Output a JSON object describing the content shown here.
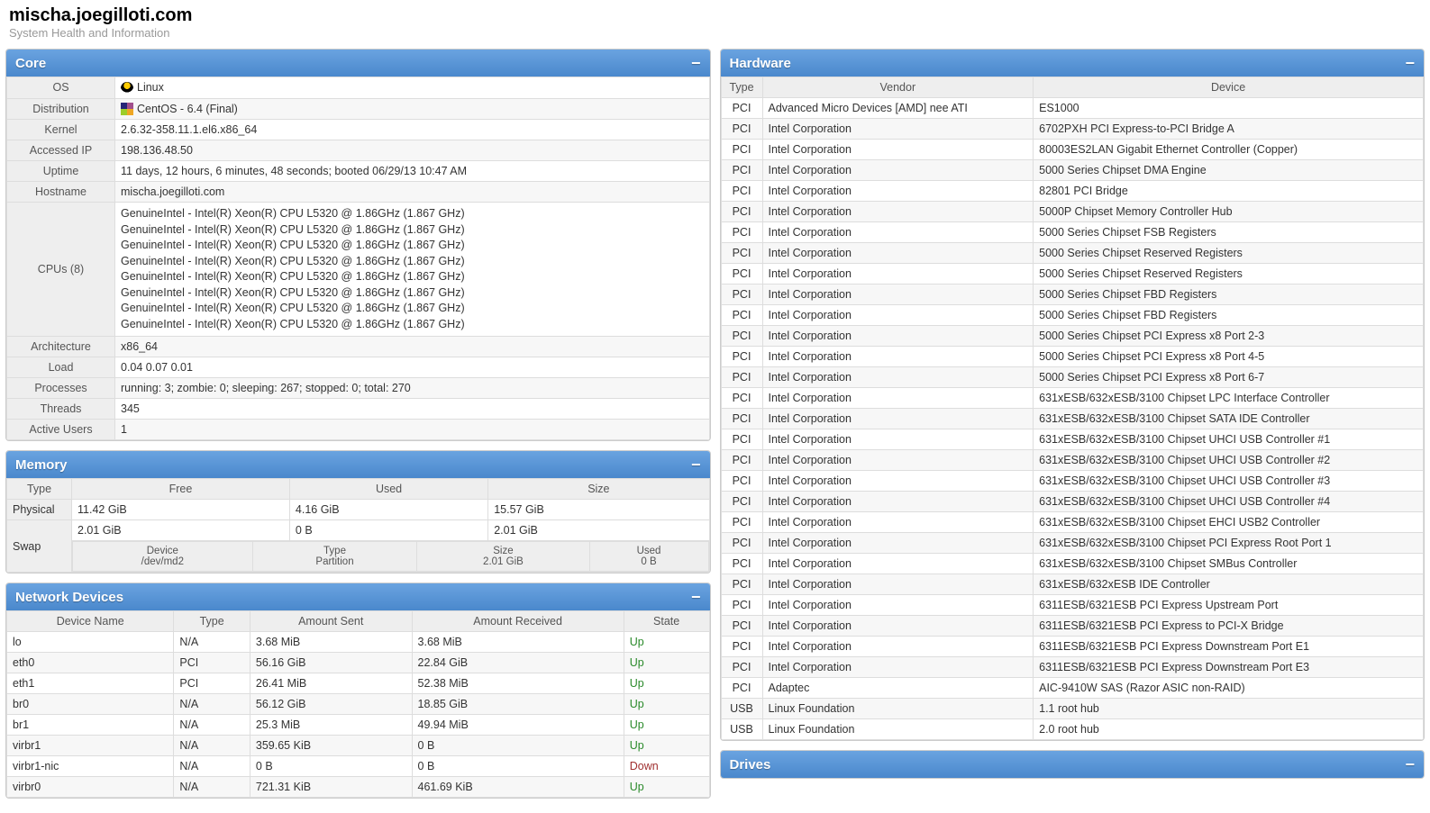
{
  "header": {
    "title": "mischa.joegilloti.com",
    "subtitle": "System Health and Information"
  },
  "core": {
    "title": "Core",
    "rows": {
      "os_label": "OS",
      "os_value": "Linux",
      "dist_label": "Distribution",
      "dist_value": "CentOS - 6.4 (Final)",
      "kernel_label": "Kernel",
      "kernel_value": "2.6.32-358.11.1.el6.x86_64",
      "ip_label": "Accessed IP",
      "ip_value": "198.136.48.50",
      "uptime_label": "Uptime",
      "uptime_value": "11 days, 12 hours, 6 minutes, 48 seconds; booted 06/29/13 10:47 AM",
      "hostname_label": "Hostname",
      "hostname_value": "mischa.joegilloti.com",
      "cpus_label": "CPUs (8)",
      "cpus_value": "GenuineIntel - Intel(R) Xeon(R) CPU L5320 @ 1.86GHz (1.867 GHz)\nGenuineIntel - Intel(R) Xeon(R) CPU L5320 @ 1.86GHz (1.867 GHz)\nGenuineIntel - Intel(R) Xeon(R) CPU L5320 @ 1.86GHz (1.867 GHz)\nGenuineIntel - Intel(R) Xeon(R) CPU L5320 @ 1.86GHz (1.867 GHz)\nGenuineIntel - Intel(R) Xeon(R) CPU L5320 @ 1.86GHz (1.867 GHz)\nGenuineIntel - Intel(R) Xeon(R) CPU L5320 @ 1.86GHz (1.867 GHz)\nGenuineIntel - Intel(R) Xeon(R) CPU L5320 @ 1.86GHz (1.867 GHz)\nGenuineIntel - Intel(R) Xeon(R) CPU L5320 @ 1.86GHz (1.867 GHz)",
      "arch_label": "Architecture",
      "arch_value": "x86_64",
      "load_label": "Load",
      "load_value": "0.04 0.07 0.01",
      "proc_label": "Processes",
      "proc_value": "running: 3; zombie: 0; sleeping: 267; stopped: 0; total: 270",
      "threads_label": "Threads",
      "threads_value": "345",
      "users_label": "Active Users",
      "users_value": "1"
    }
  },
  "memory": {
    "title": "Memory",
    "headers": {
      "type": "Type",
      "free": "Free",
      "used": "Used",
      "size": "Size"
    },
    "physical": {
      "label": "Physical",
      "free": "11.42 GiB",
      "used": "4.16 GiB",
      "size": "15.57 GiB"
    },
    "swap": {
      "label": "Swap",
      "free": "2.01 GiB",
      "used": "0 B",
      "size": "2.01 GiB",
      "sub_headers": {
        "device": "Device",
        "type": "Type",
        "size": "Size",
        "used": "Used"
      },
      "sub": {
        "device": "/dev/md2",
        "type": "Partition",
        "size": "2.01 GiB",
        "used": "0 B"
      }
    }
  },
  "network": {
    "title": "Network Devices",
    "headers": {
      "name": "Device Name",
      "type": "Type",
      "sent": "Amount Sent",
      "recv": "Amount Received",
      "state": "State"
    },
    "rows": [
      {
        "name": "lo",
        "type": "N/A",
        "sent": "3.68 MiB",
        "recv": "3.68 MiB",
        "state": "Up"
      },
      {
        "name": "eth0",
        "type": "PCI",
        "sent": "56.16 GiB",
        "recv": "22.84 GiB",
        "state": "Up"
      },
      {
        "name": "eth1",
        "type": "PCI",
        "sent": "26.41 MiB",
        "recv": "52.38 MiB",
        "state": "Up"
      },
      {
        "name": "br0",
        "type": "N/A",
        "sent": "56.12 GiB",
        "recv": "18.85 GiB",
        "state": "Up"
      },
      {
        "name": "br1",
        "type": "N/A",
        "sent": "25.3 MiB",
        "recv": "49.94 MiB",
        "state": "Up"
      },
      {
        "name": "virbr1",
        "type": "N/A",
        "sent": "359.65 KiB",
        "recv": "0 B",
        "state": "Up"
      },
      {
        "name": "virbr1-nic",
        "type": "N/A",
        "sent": "0 B",
        "recv": "0 B",
        "state": "Down"
      },
      {
        "name": "virbr0",
        "type": "N/A",
        "sent": "721.31 KiB",
        "recv": "461.69 KiB",
        "state": "Up"
      }
    ]
  },
  "hardware": {
    "title": "Hardware",
    "headers": {
      "type": "Type",
      "vendor": "Vendor",
      "device": "Device"
    },
    "rows": [
      {
        "type": "PCI",
        "vendor": "Advanced Micro Devices [AMD] nee ATI",
        "device": "ES1000"
      },
      {
        "type": "PCI",
        "vendor": "Intel Corporation",
        "device": "6702PXH PCI Express-to-PCI Bridge A"
      },
      {
        "type": "PCI",
        "vendor": "Intel Corporation",
        "device": "80003ES2LAN Gigabit Ethernet Controller (Copper)"
      },
      {
        "type": "PCI",
        "vendor": "Intel Corporation",
        "device": "5000 Series Chipset DMA Engine"
      },
      {
        "type": "PCI",
        "vendor": "Intel Corporation",
        "device": "82801 PCI Bridge"
      },
      {
        "type": "PCI",
        "vendor": "Intel Corporation",
        "device": "5000P Chipset Memory Controller Hub"
      },
      {
        "type": "PCI",
        "vendor": "Intel Corporation",
        "device": "5000 Series Chipset FSB Registers"
      },
      {
        "type": "PCI",
        "vendor": "Intel Corporation",
        "device": "5000 Series Chipset Reserved Registers"
      },
      {
        "type": "PCI",
        "vendor": "Intel Corporation",
        "device": "5000 Series Chipset Reserved Registers"
      },
      {
        "type": "PCI",
        "vendor": "Intel Corporation",
        "device": "5000 Series Chipset FBD Registers"
      },
      {
        "type": "PCI",
        "vendor": "Intel Corporation",
        "device": "5000 Series Chipset FBD Registers"
      },
      {
        "type": "PCI",
        "vendor": "Intel Corporation",
        "device": "5000 Series Chipset PCI Express x8 Port 2-3"
      },
      {
        "type": "PCI",
        "vendor": "Intel Corporation",
        "device": "5000 Series Chipset PCI Express x8 Port 4-5"
      },
      {
        "type": "PCI",
        "vendor": "Intel Corporation",
        "device": "5000 Series Chipset PCI Express x8 Port 6-7"
      },
      {
        "type": "PCI",
        "vendor": "Intel Corporation",
        "device": "631xESB/632xESB/3100 Chipset LPC Interface Controller"
      },
      {
        "type": "PCI",
        "vendor": "Intel Corporation",
        "device": "631xESB/632xESB/3100 Chipset SATA IDE Controller"
      },
      {
        "type": "PCI",
        "vendor": "Intel Corporation",
        "device": "631xESB/632xESB/3100 Chipset UHCI USB Controller #1"
      },
      {
        "type": "PCI",
        "vendor": "Intel Corporation",
        "device": "631xESB/632xESB/3100 Chipset UHCI USB Controller #2"
      },
      {
        "type": "PCI",
        "vendor": "Intel Corporation",
        "device": "631xESB/632xESB/3100 Chipset UHCI USB Controller #3"
      },
      {
        "type": "PCI",
        "vendor": "Intel Corporation",
        "device": "631xESB/632xESB/3100 Chipset UHCI USB Controller #4"
      },
      {
        "type": "PCI",
        "vendor": "Intel Corporation",
        "device": "631xESB/632xESB/3100 Chipset EHCI USB2 Controller"
      },
      {
        "type": "PCI",
        "vendor": "Intel Corporation",
        "device": "631xESB/632xESB/3100 Chipset PCI Express Root Port 1"
      },
      {
        "type": "PCI",
        "vendor": "Intel Corporation",
        "device": "631xESB/632xESB/3100 Chipset SMBus Controller"
      },
      {
        "type": "PCI",
        "vendor": "Intel Corporation",
        "device": "631xESB/632xESB IDE Controller"
      },
      {
        "type": "PCI",
        "vendor": "Intel Corporation",
        "device": "6311ESB/6321ESB PCI Express Upstream Port"
      },
      {
        "type": "PCI",
        "vendor": "Intel Corporation",
        "device": "6311ESB/6321ESB PCI Express to PCI-X Bridge"
      },
      {
        "type": "PCI",
        "vendor": "Intel Corporation",
        "device": "6311ESB/6321ESB PCI Express Downstream Port E1"
      },
      {
        "type": "PCI",
        "vendor": "Intel Corporation",
        "device": "6311ESB/6321ESB PCI Express Downstream Port E3"
      },
      {
        "type": "PCI",
        "vendor": "Adaptec",
        "device": "AIC-9410W SAS (Razor ASIC non-RAID)"
      },
      {
        "type": "USB",
        "vendor": "Linux Foundation",
        "device": "1.1 root hub"
      },
      {
        "type": "USB",
        "vendor": "Linux Foundation",
        "device": "2.0 root hub"
      }
    ]
  },
  "drives": {
    "title": "Drives"
  }
}
